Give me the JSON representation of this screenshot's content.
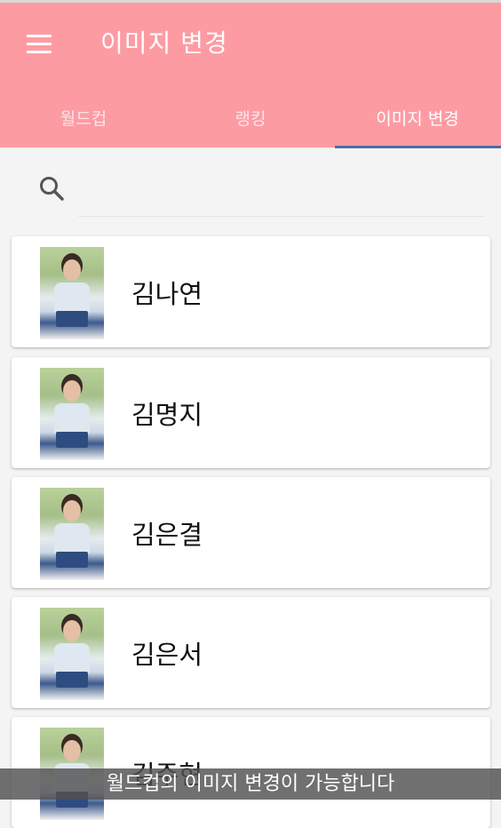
{
  "appbar": {
    "title": "이미지 변경",
    "background": "#fd9ba3",
    "menu_icon": "menu-icon"
  },
  "tabs": [
    {
      "label": "월드컵",
      "active": false
    },
    {
      "label": "랭킹",
      "active": false
    },
    {
      "label": "이미지 변경",
      "active": true
    }
  ],
  "tab_indicator_color": "#4f6ba6",
  "search": {
    "icon": "search-icon",
    "value": "",
    "placeholder": ""
  },
  "members": [
    {
      "name": "김나연"
    },
    {
      "name": "김명지"
    },
    {
      "name": "김은결"
    },
    {
      "name": "김은서"
    },
    {
      "name": "김주현"
    }
  ],
  "toast": {
    "text": "월드컵의 이미지 변경이 가능합니다"
  }
}
